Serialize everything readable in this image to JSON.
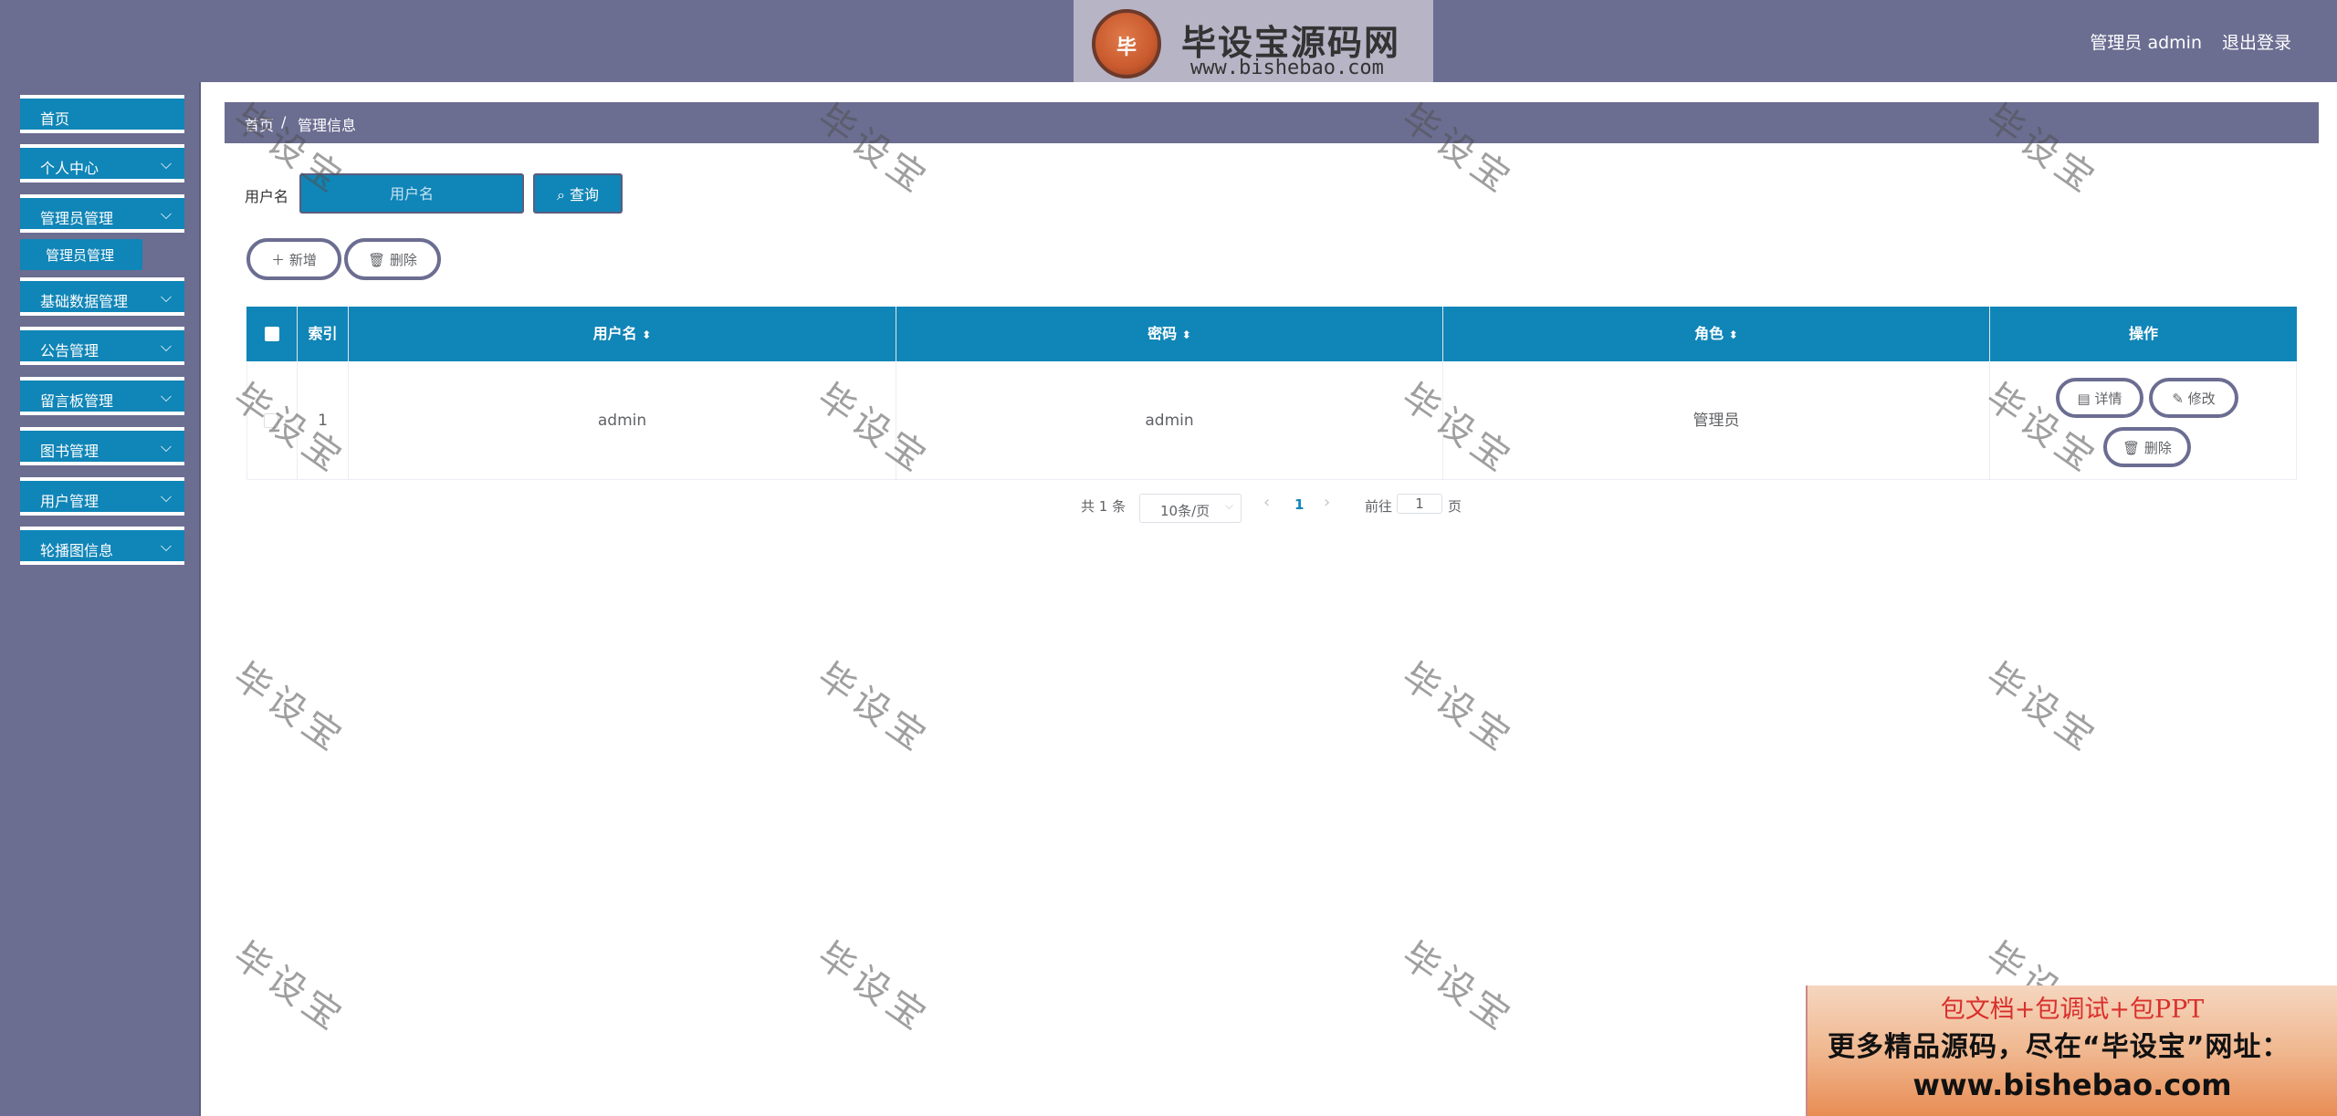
{
  "header": {
    "user": "管理员 admin",
    "logout": "退出登录",
    "logo": {
      "badge_text": "毕",
      "title": "毕设宝源码网",
      "url": "www.bishebao.com"
    }
  },
  "sidebar": {
    "items": [
      {
        "label": "首页",
        "has_children": false
      },
      {
        "label": "个人中心",
        "has_children": true
      },
      {
        "label": "管理员管理",
        "has_children": true
      },
      {
        "label": "基础数据管理",
        "has_children": true
      },
      {
        "label": "公告管理",
        "has_children": true
      },
      {
        "label": "留言板管理",
        "has_children": true
      },
      {
        "label": "图书管理",
        "has_children": true
      },
      {
        "label": "用户管理",
        "has_children": true
      },
      {
        "label": "轮播图信息",
        "has_children": true
      }
    ],
    "submenu": {
      "label": "管理员管理"
    }
  },
  "breadcrumb": {
    "home": "首页",
    "separator": "/",
    "current": "管理信息"
  },
  "search": {
    "label": "用户名",
    "placeholder": "用户名",
    "button": "查询"
  },
  "actions": {
    "add": "新增",
    "delete": "删除"
  },
  "table": {
    "columns": [
      "索引",
      "用户名",
      "密码",
      "角色",
      "操作"
    ],
    "rows": [
      {
        "index": "1",
        "username": "admin",
        "password": "admin",
        "role": "管理员"
      }
    ],
    "ops": {
      "detail": "详情",
      "edit": "修改",
      "delete": "删除"
    }
  },
  "pagination": {
    "total": "共 1 条",
    "page_size": "10条/页",
    "current_page": "1",
    "goto_label": "前往",
    "goto_value": "1",
    "goto_unit": "页"
  },
  "watermark": "毕设宝",
  "promo": {
    "line1": "包文档+包调试+包PPT",
    "line2": "更多精品源码，尽在“毕设宝”网址：",
    "line3": "www.bishebao.com"
  },
  "colors": {
    "header_bg": "#6b6d91",
    "accent": "#1085b7",
    "button_border": "#6b6d91"
  },
  "icons": [
    "chevron-down-icon",
    "search-icon",
    "plus-icon",
    "trash-icon",
    "document-icon",
    "edit-icon",
    "chevron-left-icon",
    "chevron-right-icon",
    "sort-icon"
  ]
}
